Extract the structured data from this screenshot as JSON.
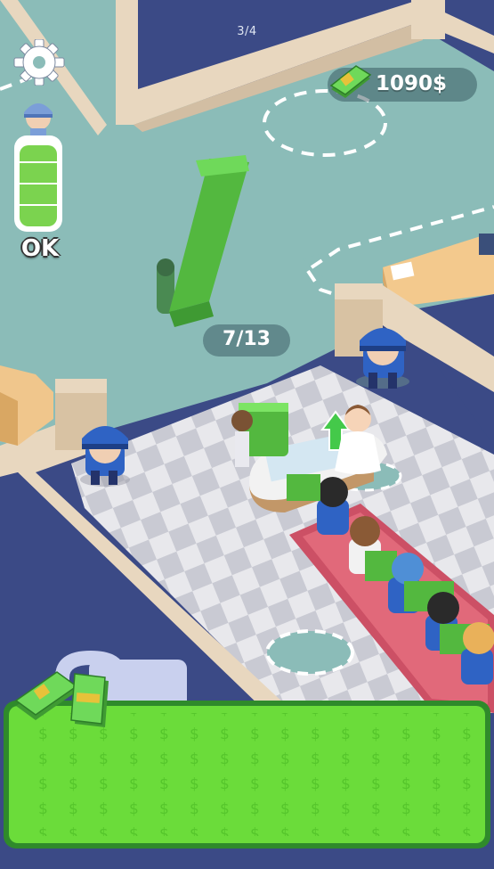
{
  "hud": {
    "page_indicator": "3/4",
    "money": "1090$",
    "status": "OK",
    "energy_level": 0.95
  },
  "counter": {
    "label": "7/13",
    "current": 7,
    "capacity": 13
  },
  "icons": {
    "settings": "gear-icon",
    "cash": "cash-stack-icon",
    "upgrade": "green-up-arrow-icon",
    "guard": "police-officer-icon"
  },
  "colors": {
    "floor_teal": "#8bbcb8",
    "wall_navy": "#3b4a86",
    "wall_beige": "#e8d7bf",
    "checker_light": "#e8e8ec",
    "checker_dark": "#c9cad3",
    "cash_green": "#5ed24a",
    "carpet_red": "#cc5065",
    "police_blue": "#2f63c4"
  }
}
